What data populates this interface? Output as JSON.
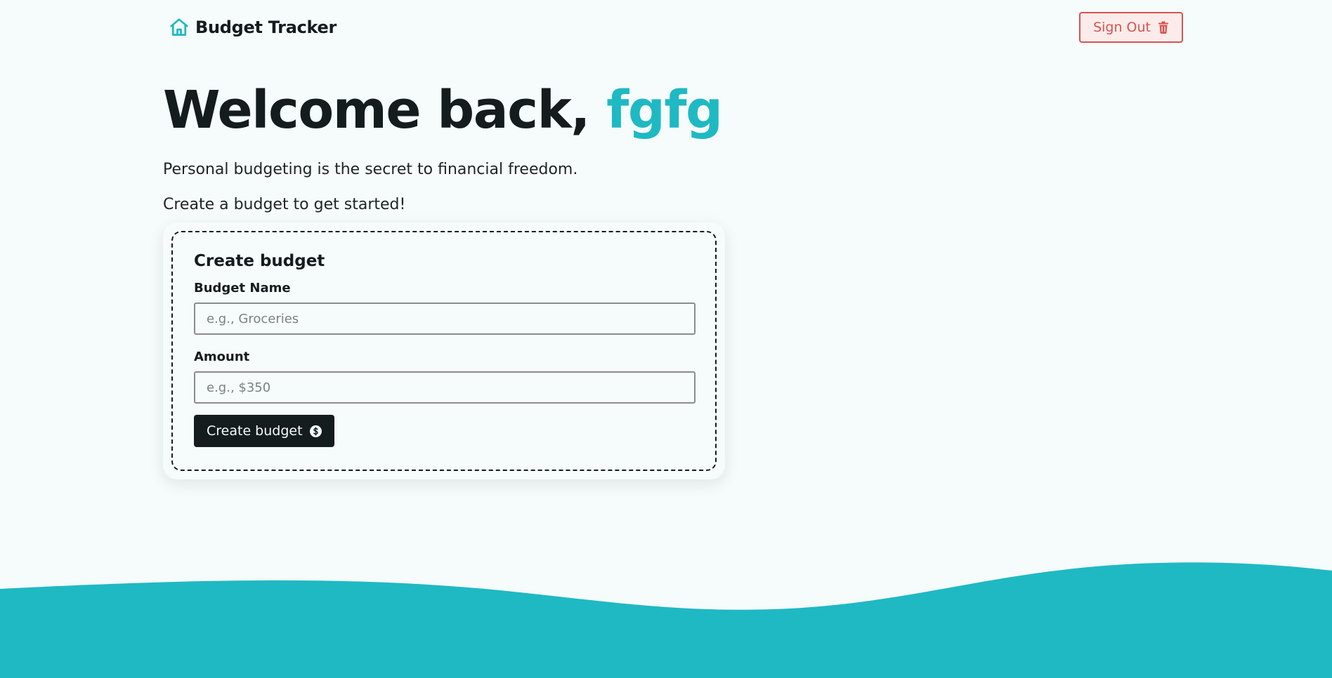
{
  "header": {
    "brand_label": "Budget Tracker",
    "brand_icon": "home-icon",
    "signout_label": "Sign Out",
    "signout_icon": "trash-icon"
  },
  "hero": {
    "greeting": "Welcome back, ",
    "username": "fgfg",
    "tagline": "Personal budgeting is the secret to financial freedom.",
    "cta": "Create a budget to get started!"
  },
  "form": {
    "title": "Create budget",
    "name_label": "Budget Name",
    "name_placeholder": "e.g., Groceries",
    "name_value": "",
    "amount_label": "Amount",
    "amount_placeholder": "e.g., $350",
    "amount_value": "",
    "submit_label": "Create budget",
    "submit_icon": "dollar-circle-icon"
  },
  "colors": {
    "accent": "#1fb9c3",
    "background": "#f6fbfb",
    "text": "#141c1d",
    "danger": "#d9534f",
    "danger_bg": "#fbeceb"
  }
}
